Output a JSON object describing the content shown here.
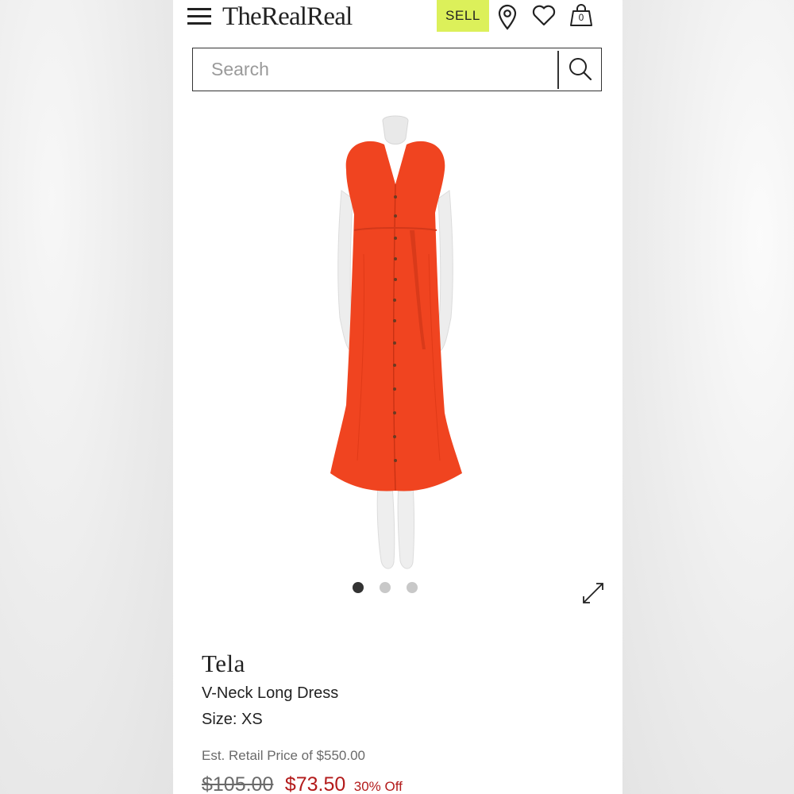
{
  "header": {
    "logo": "TheRealReal",
    "sell_label": "SELL",
    "cart_count": "0"
  },
  "search": {
    "placeholder": "Search"
  },
  "gallery": {
    "image_count": 3,
    "active_index": 0
  },
  "product": {
    "brand": "Tela",
    "name": "V-Neck Long Dress",
    "size": "Size: XS",
    "retail_price": "Est. Retail Price of $550.00",
    "original_price": "$105.00",
    "sale_price": "$73.50",
    "discount": "30% Off",
    "dress_color": "#f04420"
  },
  "colors": {
    "sell_bg": "#dcf05a",
    "sale_red": "#b31b1b"
  },
  "icons": {
    "menu": "hamburger-menu-icon",
    "location": "map-pin-icon",
    "wishlist": "heart-icon",
    "cart": "shopping-bag-icon",
    "search": "magnifier-icon",
    "expand": "expand-arrows-icon"
  }
}
